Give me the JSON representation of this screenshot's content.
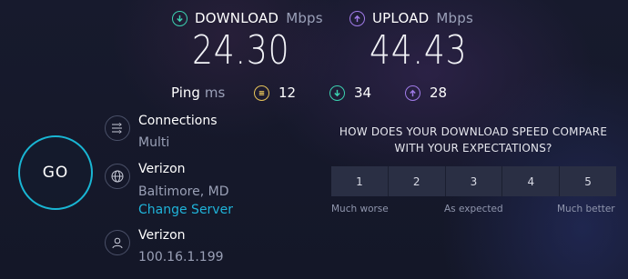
{
  "download": {
    "label": "DOWNLOAD",
    "unit": "Mbps",
    "value": "24.30",
    "color": "#3bd1b0"
  },
  "upload": {
    "label": "UPLOAD",
    "unit": "Mbps",
    "value": "44.43",
    "color": "#a07be8"
  },
  "ping": {
    "label": "Ping",
    "unit": "ms",
    "idle": "12",
    "download": "34",
    "upload": "28",
    "idle_color": "#e7c45a",
    "download_color": "#3bd1b0",
    "upload_color": "#a07be8"
  },
  "go_button": {
    "label": "GO"
  },
  "connections": {
    "title": "Connections",
    "value": "Multi",
    "icon": "connections-icon"
  },
  "server": {
    "title": "Verizon",
    "location": "Baltimore, MD",
    "change_link": "Change Server",
    "icon": "globe-icon"
  },
  "provider": {
    "title": "Verizon",
    "ip": "100.16.1.199",
    "icon": "user-icon"
  },
  "survey": {
    "question_line1": "HOW DOES YOUR DOWNLOAD SPEED COMPARE",
    "question_line2": "WITH YOUR EXPECTATIONS?",
    "options": [
      "1",
      "2",
      "3",
      "4",
      "5"
    ],
    "scale_low": "Much worse",
    "scale_mid": "As expected",
    "scale_high": "Much better"
  }
}
